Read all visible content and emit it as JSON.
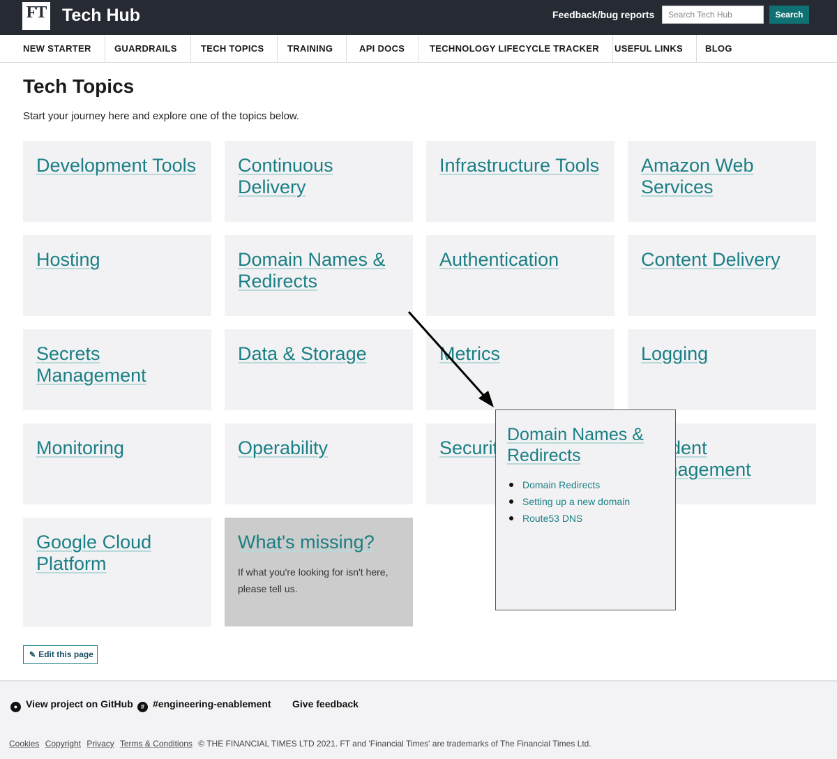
{
  "header": {
    "logo_text": "FT",
    "site_title": "Tech Hub",
    "feedback_link": "Feedback/bug reports",
    "search_placeholder": "Search Tech Hub",
    "search_button": "Search"
  },
  "nav": {
    "items": [
      {
        "label": "NEW STARTER"
      },
      {
        "label": "GUARDRAILS"
      },
      {
        "label": "TECH TOPICS"
      },
      {
        "label": "TRAINING"
      },
      {
        "label": "API DOCS"
      },
      {
        "label": "TECHNOLOGY LIFECYCLE TRACKER"
      },
      {
        "label": "USEFUL LINKS"
      },
      {
        "label": "BLOG"
      }
    ]
  },
  "main": {
    "title": "Tech Topics",
    "intro": "Start your journey here and explore one of the topics below.",
    "cards": [
      "Development Tools",
      "Continuous Delivery",
      "Infrastructure Tools",
      "Amazon Web Services",
      "Hosting",
      "Domain Names & Redirects",
      "Authentication",
      "Content Delivery",
      "Secrets Management",
      "Data & Storage",
      "Metrics",
      "Logging",
      "Monitoring",
      "Operability",
      "Security",
      "Incident Management",
      "Google Cloud Platform"
    ],
    "missing_card": {
      "title": "What's missing?",
      "text": "If what you're looking for isn't here, please tell us."
    },
    "edit_button": "Edit this page"
  },
  "popup": {
    "title": "Domain Names & Redirects",
    "items": [
      "Domain Redirects",
      "Setting up a new domain",
      "Route53 DNS"
    ]
  },
  "footer": {
    "github_link": "View project on GitHub",
    "slack_link": "#engineering-enablement",
    "feedback_link": "Give feedback",
    "legal_links": [
      "Cookies",
      "Copyright",
      "Privacy",
      "Terms & Conditions"
    ],
    "copyright": "© THE FINANCIAL TIMES LTD 2021. FT and 'Financial Times' are trademarks of The Financial Times Ltd."
  }
}
